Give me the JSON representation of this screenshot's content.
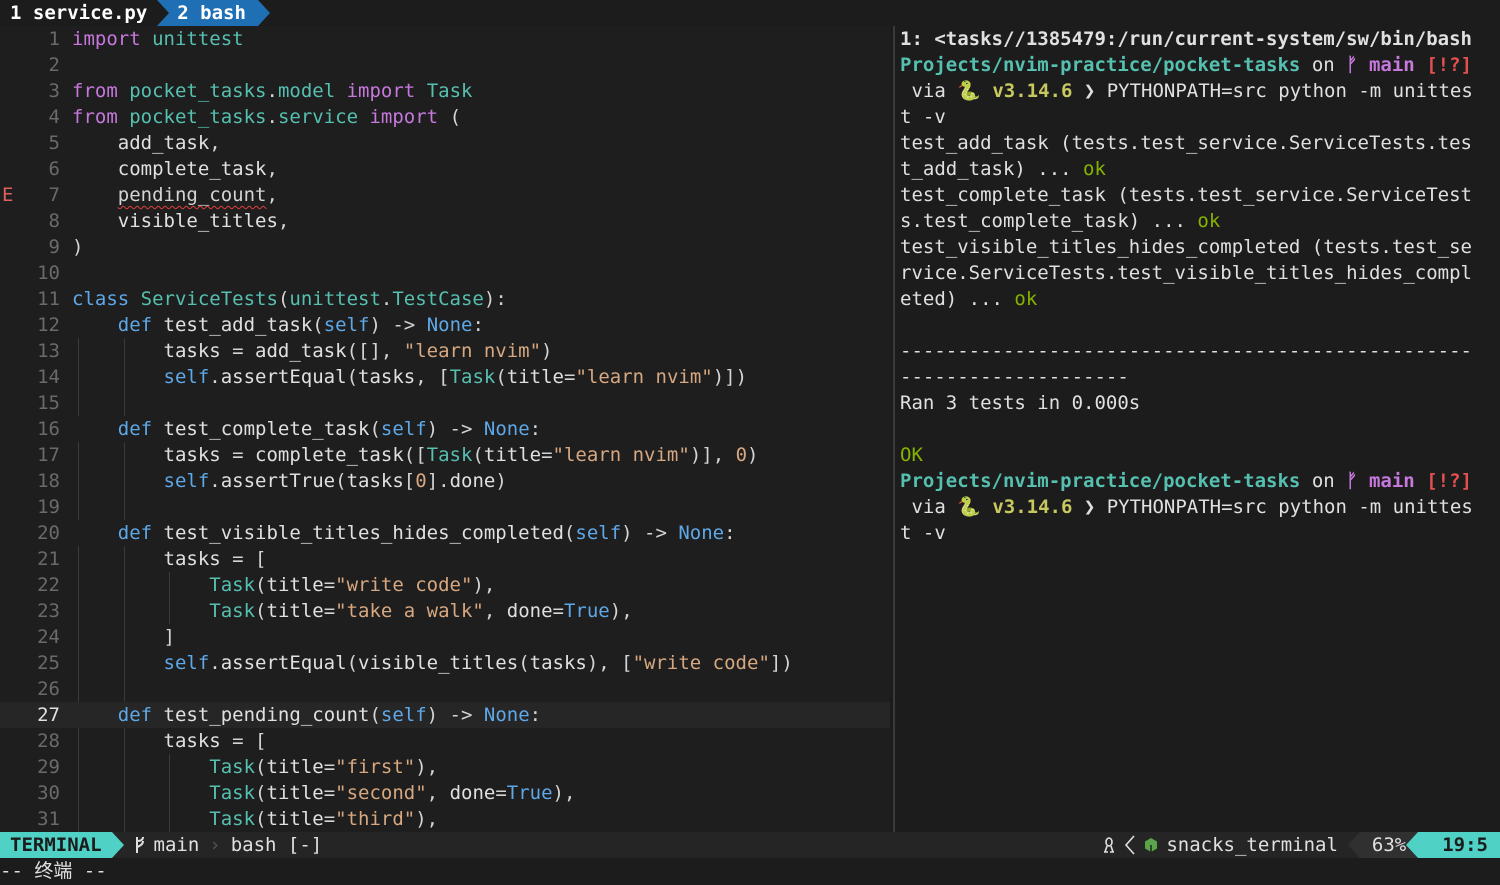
{
  "tabs": [
    {
      "label": "1 service.py",
      "active": false
    },
    {
      "label": "2 bash",
      "active": true
    }
  ],
  "editor": {
    "current_line": 27,
    "sign_line": 7,
    "sign_text": "E",
    "lines": [
      {
        "n": "1",
        "tokens": [
          [
            "kw",
            "import"
          ],
          [
            "p",
            " "
          ],
          [
            "mod",
            "unittest"
          ]
        ]
      },
      {
        "n": "2",
        "tokens": []
      },
      {
        "n": "3",
        "tokens": [
          [
            "kw",
            "from"
          ],
          [
            "p",
            " "
          ],
          [
            "mod",
            "pocket_tasks"
          ],
          [
            "p",
            "."
          ],
          [
            "mod",
            "model"
          ],
          [
            "p",
            " "
          ],
          [
            "kw",
            "import"
          ],
          [
            "p",
            " "
          ],
          [
            "cls",
            "Task"
          ]
        ]
      },
      {
        "n": "4",
        "tokens": [
          [
            "kw",
            "from"
          ],
          [
            "p",
            " "
          ],
          [
            "mod",
            "pocket_tasks"
          ],
          [
            "p",
            "."
          ],
          [
            "mod",
            "service"
          ],
          [
            "p",
            " "
          ],
          [
            "kw",
            "import"
          ],
          [
            "p",
            " ("
          ]
        ]
      },
      {
        "n": "5",
        "tokens": [
          [
            "p",
            "    "
          ],
          [
            "var",
            "add_task"
          ],
          [
            "p",
            ","
          ]
        ]
      },
      {
        "n": "6",
        "tokens": [
          [
            "p",
            "    "
          ],
          [
            "var",
            "complete_task"
          ],
          [
            "p",
            ","
          ]
        ]
      },
      {
        "n": "7",
        "tokens": [
          [
            "p",
            "    "
          ],
          [
            "err",
            "pending_count"
          ],
          [
            "p",
            ","
          ]
        ]
      },
      {
        "n": "8",
        "tokens": [
          [
            "p",
            "    "
          ],
          [
            "var",
            "visible_titles"
          ],
          [
            "p",
            ","
          ]
        ]
      },
      {
        "n": "9",
        "tokens": [
          [
            "p",
            ")"
          ]
        ]
      },
      {
        "n": "10",
        "tokens": []
      },
      {
        "n": "11",
        "tokens": [
          [
            "slf",
            "class"
          ],
          [
            "p",
            " "
          ],
          [
            "cls",
            "ServiceTests"
          ],
          [
            "p",
            "("
          ],
          [
            "mod",
            "unittest"
          ],
          [
            "p",
            "."
          ],
          [
            "cls",
            "TestCase"
          ],
          [
            "p",
            "):"
          ]
        ]
      },
      {
        "n": "12",
        "tokens": [
          [
            "p",
            "    "
          ],
          [
            "slf",
            "def"
          ],
          [
            "p",
            " "
          ],
          [
            "fn",
            "test_add_task"
          ],
          [
            "p",
            "("
          ],
          [
            "slf",
            "self"
          ],
          [
            "p",
            ") -> "
          ],
          [
            "none",
            "None"
          ],
          [
            "p",
            ":"
          ]
        ]
      },
      {
        "n": "13",
        "tokens": [
          [
            "p",
            "        "
          ],
          [
            "var",
            "tasks"
          ],
          [
            "p",
            " = "
          ],
          [
            "fn",
            "add_task"
          ],
          [
            "p",
            "([], "
          ],
          [
            "str",
            "\"learn nvim\""
          ],
          [
            "p",
            ")"
          ]
        ]
      },
      {
        "n": "14",
        "tokens": [
          [
            "p",
            "        "
          ],
          [
            "slf",
            "self"
          ],
          [
            "p",
            "."
          ],
          [
            "fn",
            "assertEqual"
          ],
          [
            "p",
            "("
          ],
          [
            "var",
            "tasks"
          ],
          [
            "p",
            ", ["
          ],
          [
            "cls",
            "Task"
          ],
          [
            "p",
            "("
          ],
          [
            "var",
            "title"
          ],
          [
            "p",
            "="
          ],
          [
            "str",
            "\"learn nvim\""
          ],
          [
            "p",
            ")])"
          ]
        ]
      },
      {
        "n": "15",
        "tokens": []
      },
      {
        "n": "16",
        "tokens": [
          [
            "p",
            "    "
          ],
          [
            "slf",
            "def"
          ],
          [
            "p",
            " "
          ],
          [
            "fn",
            "test_complete_task"
          ],
          [
            "p",
            "("
          ],
          [
            "slf",
            "self"
          ],
          [
            "p",
            ") -> "
          ],
          [
            "none",
            "None"
          ],
          [
            "p",
            ":"
          ]
        ]
      },
      {
        "n": "17",
        "tokens": [
          [
            "p",
            "        "
          ],
          [
            "var",
            "tasks"
          ],
          [
            "p",
            " = "
          ],
          [
            "fn",
            "complete_task"
          ],
          [
            "p",
            "(["
          ],
          [
            "cls",
            "Task"
          ],
          [
            "p",
            "("
          ],
          [
            "var",
            "title"
          ],
          [
            "p",
            "="
          ],
          [
            "str",
            "\"learn nvim\""
          ],
          [
            "p",
            ")], "
          ],
          [
            "num",
            "0"
          ],
          [
            "p",
            ")"
          ]
        ]
      },
      {
        "n": "18",
        "tokens": [
          [
            "p",
            "        "
          ],
          [
            "slf",
            "self"
          ],
          [
            "p",
            "."
          ],
          [
            "fn",
            "assertTrue"
          ],
          [
            "p",
            "("
          ],
          [
            "var",
            "tasks"
          ],
          [
            "p",
            "["
          ],
          [
            "num",
            "0"
          ],
          [
            "p",
            "]."
          ],
          [
            "var",
            "done"
          ],
          [
            "p",
            ")"
          ]
        ]
      },
      {
        "n": "19",
        "tokens": []
      },
      {
        "n": "20",
        "tokens": [
          [
            "p",
            "    "
          ],
          [
            "slf",
            "def"
          ],
          [
            "p",
            " "
          ],
          [
            "fn",
            "test_visible_titles_hides_completed"
          ],
          [
            "p",
            "("
          ],
          [
            "slf",
            "self"
          ],
          [
            "p",
            ") -> "
          ],
          [
            "none",
            "None"
          ],
          [
            "p",
            ":"
          ]
        ]
      },
      {
        "n": "21",
        "tokens": [
          [
            "p",
            "        "
          ],
          [
            "var",
            "tasks"
          ],
          [
            "p",
            " = ["
          ]
        ]
      },
      {
        "n": "22",
        "tokens": [
          [
            "p",
            "            "
          ],
          [
            "cls",
            "Task"
          ],
          [
            "p",
            "("
          ],
          [
            "var",
            "title"
          ],
          [
            "p",
            "="
          ],
          [
            "str",
            "\"write code\""
          ],
          [
            "p",
            "),"
          ]
        ]
      },
      {
        "n": "23",
        "tokens": [
          [
            "p",
            "            "
          ],
          [
            "cls",
            "Task"
          ],
          [
            "p",
            "("
          ],
          [
            "var",
            "title"
          ],
          [
            "p",
            "="
          ],
          [
            "str",
            "\"take a walk\""
          ],
          [
            "p",
            ", "
          ],
          [
            "var",
            "done"
          ],
          [
            "p",
            "="
          ],
          [
            "none",
            "True"
          ],
          [
            "p",
            "),"
          ]
        ]
      },
      {
        "n": "24",
        "tokens": [
          [
            "p",
            "        ]"
          ]
        ]
      },
      {
        "n": "25",
        "tokens": [
          [
            "p",
            "        "
          ],
          [
            "slf",
            "self"
          ],
          [
            "p",
            "."
          ],
          [
            "fn",
            "assertEqual"
          ],
          [
            "p",
            "("
          ],
          [
            "fn",
            "visible_titles"
          ],
          [
            "p",
            "("
          ],
          [
            "var",
            "tasks"
          ],
          [
            "p",
            "), ["
          ],
          [
            "str",
            "\"write code\""
          ],
          [
            "p",
            "])"
          ]
        ]
      },
      {
        "n": "26",
        "tokens": []
      },
      {
        "n": "27",
        "tokens": [
          [
            "p",
            "    "
          ],
          [
            "slf",
            "def"
          ],
          [
            "p",
            " "
          ],
          [
            "fn",
            "test_pending_count"
          ],
          [
            "p",
            "("
          ],
          [
            "slf",
            "self"
          ],
          [
            "p",
            ") -> "
          ],
          [
            "none",
            "None"
          ],
          [
            "p",
            ":"
          ]
        ]
      },
      {
        "n": "28",
        "tokens": [
          [
            "p",
            "        "
          ],
          [
            "var",
            "tasks"
          ],
          [
            "p",
            " = ["
          ]
        ]
      },
      {
        "n": "29",
        "tokens": [
          [
            "p",
            "            "
          ],
          [
            "cls",
            "Task"
          ],
          [
            "p",
            "("
          ],
          [
            "var",
            "title"
          ],
          [
            "p",
            "="
          ],
          [
            "str",
            "\"first\""
          ],
          [
            "p",
            "),"
          ]
        ]
      },
      {
        "n": "30",
        "tokens": [
          [
            "p",
            "            "
          ],
          [
            "cls",
            "Task"
          ],
          [
            "p",
            "("
          ],
          [
            "var",
            "title"
          ],
          [
            "p",
            "="
          ],
          [
            "str",
            "\"second\""
          ],
          [
            "p",
            ", "
          ],
          [
            "var",
            "done"
          ],
          [
            "p",
            "="
          ],
          [
            "none",
            "True"
          ],
          [
            "p",
            "),"
          ]
        ]
      },
      {
        "n": "31",
        "tokens": [
          [
            "p",
            "            "
          ],
          [
            "cls",
            "Task"
          ],
          [
            "p",
            "("
          ],
          [
            "var",
            "title"
          ],
          [
            "p",
            "="
          ],
          [
            "str",
            "\"third\""
          ],
          [
            "p",
            "),"
          ]
        ]
      }
    ]
  },
  "terminal": {
    "lines": [
      {
        "segs": [
          [
            "bold",
            "1: <tasks//1385479:/run/current-system/sw/bin/bash"
          ]
        ]
      },
      {
        "segs": [
          [
            "path",
            "Projects/nvim-practice/pocket-tasks"
          ],
          [
            "plain",
            " on "
          ],
          [
            "branch",
            "ᚠ main"
          ],
          [
            "plain",
            " "
          ],
          [
            "gst",
            "[!?]"
          ]
        ]
      },
      {
        "segs": [
          [
            "plain",
            " via "
          ],
          [
            "plain",
            "🐍 "
          ],
          [
            "ver",
            "v3.14.6"
          ],
          [
            "plain",
            " ❯ PYTHONPATH=src python -m unittes"
          ]
        ]
      },
      {
        "segs": [
          [
            "plain",
            "t -v"
          ]
        ]
      },
      {
        "segs": [
          [
            "plain",
            "test_add_task (tests.test_service.ServiceTests.tes"
          ]
        ]
      },
      {
        "segs": [
          [
            "plain",
            "t_add_task) ... "
          ],
          [
            "ok",
            "ok"
          ]
        ]
      },
      {
        "segs": [
          [
            "plain",
            "test_complete_task (tests.test_service.ServiceTest"
          ]
        ]
      },
      {
        "segs": [
          [
            "plain",
            "s.test_complete_task) ... "
          ],
          [
            "ok",
            "ok"
          ]
        ]
      },
      {
        "segs": [
          [
            "plain",
            "test_visible_titles_hides_completed (tests.test_se"
          ]
        ]
      },
      {
        "segs": [
          [
            "plain",
            "rvice.ServiceTests.test_visible_titles_hides_compl"
          ]
        ]
      },
      {
        "segs": [
          [
            "plain",
            "eted) ... "
          ],
          [
            "ok",
            "ok"
          ]
        ]
      },
      {
        "segs": [
          [
            "plain",
            ""
          ]
        ]
      },
      {
        "segs": [
          [
            "plain",
            "--------------------------------------------------"
          ]
        ]
      },
      {
        "segs": [
          [
            "plain",
            "--------------------"
          ]
        ]
      },
      {
        "segs": [
          [
            "plain",
            "Ran 3 tests in 0.000s"
          ]
        ]
      },
      {
        "segs": [
          [
            "plain",
            ""
          ]
        ]
      },
      {
        "segs": [
          [
            "okc",
            "OK"
          ]
        ]
      },
      {
        "segs": [
          [
            "path",
            "Projects/nvim-practice/pocket-tasks"
          ],
          [
            "plain",
            " on "
          ],
          [
            "branch",
            "ᚠ main"
          ],
          [
            "plain",
            " "
          ],
          [
            "gst",
            "[!?]"
          ]
        ]
      },
      {
        "segs": [
          [
            "plain",
            " via "
          ],
          [
            "plain",
            "🐍 "
          ],
          [
            "ver",
            "v3.14.6"
          ],
          [
            "plain",
            " ❯ PYTHONPATH=src python -m unittes"
          ]
        ]
      },
      {
        "segs": [
          [
            "plain",
            "t -v"
          ]
        ]
      }
    ]
  },
  "statusline": {
    "mode": "TERMINAL",
    "branch": "main",
    "buffer": "bash [-]",
    "filetype": "snacks_terminal",
    "percent": "63%",
    "position": "19:5"
  },
  "cmdline": "-- 终端 --",
  "colors": {
    "accent": "#4fd1c5",
    "tab_active": "#1e6fb3"
  }
}
